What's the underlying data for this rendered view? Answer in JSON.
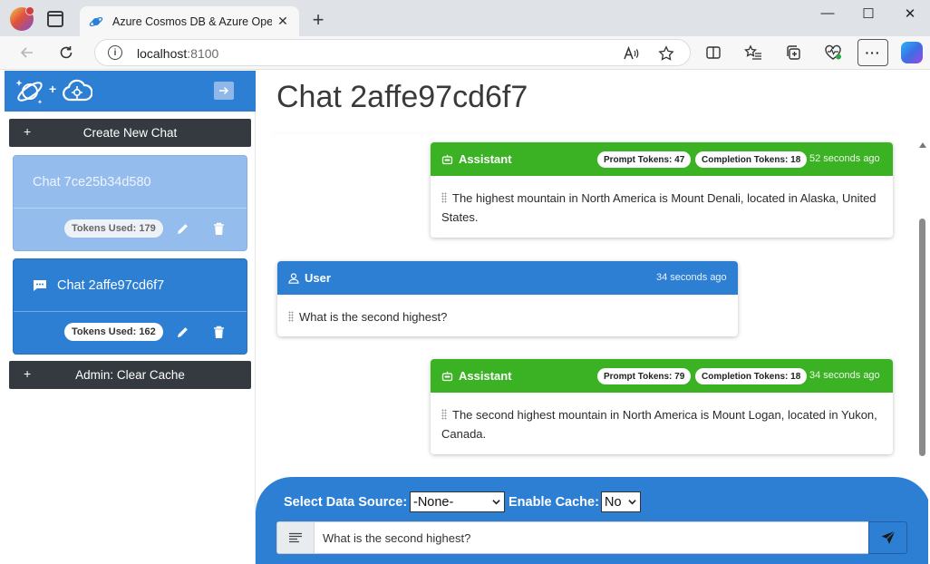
{
  "browser": {
    "tab_title": "Azure Cosmos DB & Azure Open",
    "tab_close": "✕",
    "new_tab": "+",
    "address_host": "localhost",
    "address_port": ":8100",
    "controls": {
      "minimize": "—",
      "maximize": "☐",
      "close": "✕"
    }
  },
  "sidebar": {
    "create_button": "Create New Chat",
    "clear_cache_button": "Admin: Clear Cache",
    "plus": "+",
    "sessions": [
      {
        "name": "Chat 7ce25b34d580",
        "tokens": "Tokens Used: 179",
        "active": false
      },
      {
        "name": "Chat 2affe97cd6f7",
        "tokens": "Tokens Used: 162",
        "active": true
      }
    ]
  },
  "main": {
    "heading": "Chat 2affe97cd6f7",
    "messages": [
      {
        "role": "Assistant",
        "prompt_tokens": "Prompt Tokens: 47",
        "completion_tokens": "Completion Tokens: 18",
        "time": "52 seconds ago",
        "text": "The highest mountain in North America is Mount Denali, located in Alaska, United States."
      },
      {
        "role": "User",
        "time": "34 seconds ago",
        "text": "What is the second highest?"
      },
      {
        "role": "Assistant",
        "prompt_tokens": "Prompt Tokens: 79",
        "completion_tokens": "Completion Tokens: 18",
        "time": "34 seconds ago",
        "text": "The second highest mountain in North America is Mount Logan, located in Yukon, Canada."
      }
    ]
  },
  "input": {
    "data_source_label": "Select Data Source:",
    "data_source_value": "-None-",
    "cache_label": "Enable Cache:",
    "cache_value": "No",
    "prompt_value": "What is the second highest?"
  },
  "colors": {
    "primary": "#2d7fd3",
    "assistant": "#3bb223",
    "dark": "#343a40",
    "inactive_card": "#94bdee"
  }
}
